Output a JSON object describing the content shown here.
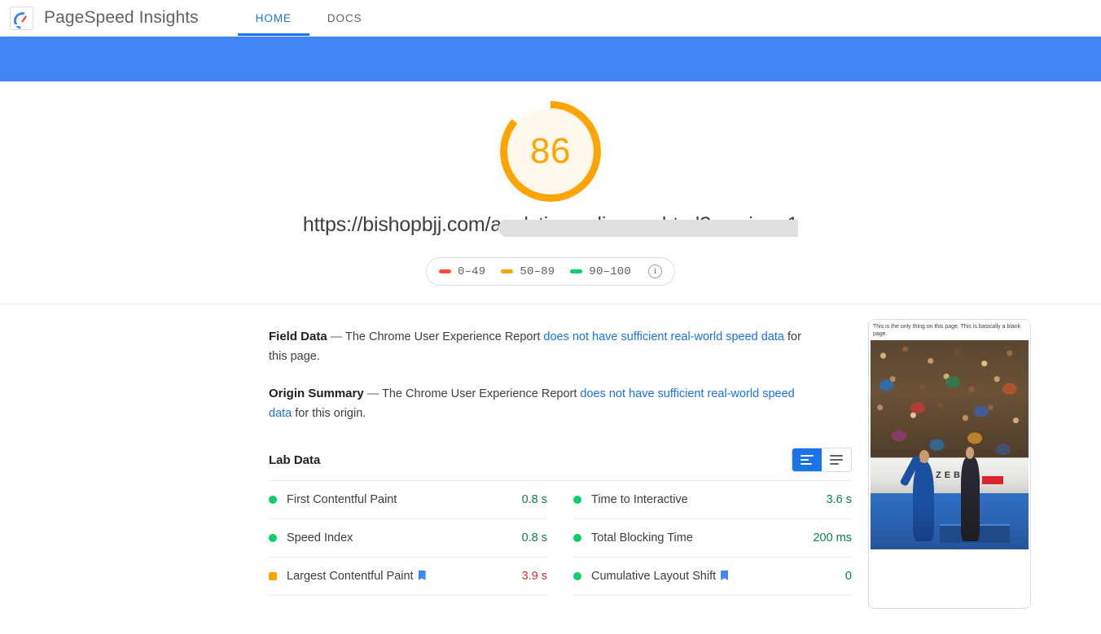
{
  "appbar": {
    "brand_title": "PageSpeed Insights",
    "logo_icon": "pagespeed-gauge-logo",
    "tabs": [
      {
        "label": "HOME",
        "active": true
      },
      {
        "label": "DOCS",
        "active": false
      }
    ]
  },
  "score": {
    "value": "86",
    "ring_color": "#FFA400",
    "fill_color": "#FFF8ED",
    "percent": 86,
    "url": "https://bishopbjj.com/analyticsandimage.html?version=1",
    "url_redacted": true
  },
  "legend": {
    "items": [
      {
        "range": "0–49",
        "color": "#FF4E42",
        "name": "legend-red"
      },
      {
        "range": "50–89",
        "color": "#FFA400",
        "name": "legend-orange"
      },
      {
        "range": "90–100",
        "color": "#0CCE6B",
        "name": "legend-green"
      }
    ],
    "info_glyph": "i"
  },
  "field_data": {
    "title": "Field Data",
    "dash": "—",
    "text_before": "The Chrome User Experience Report",
    "link_text": "does not have sufficient real-world speed data",
    "text_after": "for this page."
  },
  "origin_summary": {
    "title": "Origin Summary",
    "dash": "—",
    "text_before": "The Chrome User Experience Report",
    "link_text": "does not have sufficient real-world speed data",
    "text_after": "for this origin."
  },
  "lab_data": {
    "title": "Lab Data",
    "view_toggle": {
      "bars_icon": "bar-view-icon",
      "lines_icon": "list-view-icon",
      "active": "bars"
    },
    "metrics_left": [
      {
        "label": "First Contentful Paint",
        "value": "0.8 s",
        "status": "green",
        "dot_shape": "circle",
        "core_web_vital": false
      },
      {
        "label": "Speed Index",
        "value": "0.8 s",
        "status": "green",
        "dot_shape": "circle",
        "core_web_vital": false
      },
      {
        "label": "Largest Contentful Paint",
        "value": "3.9 s",
        "status": "orange",
        "dot_shape": "square",
        "core_web_vital": true
      }
    ],
    "metrics_right": [
      {
        "label": "Time to Interactive",
        "value": "3.6 s",
        "status": "green",
        "dot_shape": "circle",
        "core_web_vital": false
      },
      {
        "label": "Total Blocking Time",
        "value": "200 ms",
        "status": "green",
        "dot_shape": "circle",
        "core_web_vital": false
      },
      {
        "label": "Cumulative Layout Shift",
        "value": "0",
        "status": "green",
        "dot_shape": "circle",
        "core_web_vital": true
      }
    ]
  },
  "preview": {
    "caption": "This is the only thing on this page. This is basically a blank page.",
    "image_alt": "podium-photo",
    "banner_text": "ZEB"
  }
}
